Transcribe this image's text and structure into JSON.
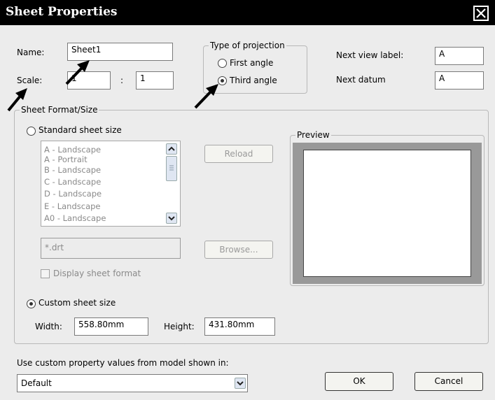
{
  "dialog": {
    "title": "Sheet Properties"
  },
  "name": {
    "label": "Name:",
    "value": "Sheet1"
  },
  "scale": {
    "label": "Scale:",
    "value1": "1",
    "separator": ":",
    "value2": "1"
  },
  "projection": {
    "title": "Type of projection",
    "first": "First angle",
    "third": "Third angle",
    "selected": "Third angle"
  },
  "next_view": {
    "label": "Next view label:",
    "value": "A"
  },
  "next_datum": {
    "label": "Next datum",
    "value": "A"
  },
  "sheet_format": {
    "title": "Sheet Format/Size",
    "standard_label": "Standard sheet size",
    "sizes": [
      "A - Landscape",
      "A - Portrait",
      "B - Landscape",
      "C - Landscape",
      "D - Landscape",
      "E - Landscape",
      "A0 - Landscape"
    ],
    "reload_label": "Reload",
    "file_value": "*.drt",
    "browse_label": "Browse...",
    "display_format_label": "Display sheet format",
    "custom_label": "Custom sheet size",
    "selected": "Custom sheet size",
    "width_label": "Width:",
    "width_value": "558.80mm",
    "height_label": "Height:",
    "height_value": "431.80mm"
  },
  "preview": {
    "title": "Preview"
  },
  "model_values": {
    "label": "Use custom property values from model shown in:",
    "selected": "Default"
  },
  "buttons": {
    "ok": "OK",
    "cancel": "Cancel"
  },
  "colors": {
    "titlebar": "#000000",
    "dialog_bg": "#ececec",
    "preview_frame": "#999999"
  }
}
